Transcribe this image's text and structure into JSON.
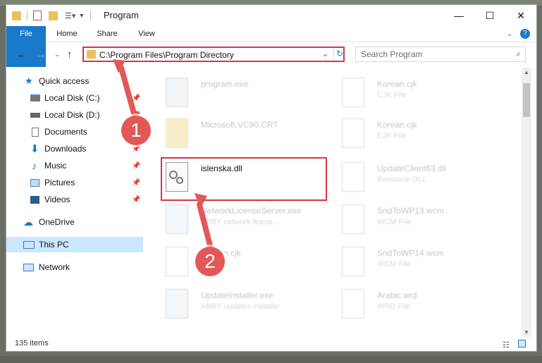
{
  "window": {
    "title": "Program",
    "minimize": "—",
    "maximize": "☐",
    "close": "✕"
  },
  "ribbon": {
    "file": "File",
    "home": "Home",
    "share": "Share",
    "view": "View",
    "help": "?"
  },
  "address": {
    "path": "C:\\Program Files\\Program Directory",
    "search_placeholder": "Search Program"
  },
  "nav": {
    "items": [
      {
        "label": "Quick access"
      },
      {
        "label": "Local Disk (C:)"
      },
      {
        "label": "Local Disk (D:)"
      },
      {
        "label": "Documents"
      },
      {
        "label": "Downloads"
      },
      {
        "label": "Music"
      },
      {
        "label": "Pictures"
      },
      {
        "label": "Videos"
      },
      {
        "label": "OneDrive"
      },
      {
        "label": "This PC"
      },
      {
        "label": "Network"
      }
    ]
  },
  "files": {
    "left": [
      {
        "name": "program.exe",
        "type": ""
      },
      {
        "name": "Microsoft.VC90.CRT",
        "type": ""
      },
      {
        "name": "islenska.dll",
        "type": ""
      },
      {
        "name": "NetworkLicenseServer.exe",
        "type": "ABBY network licens..."
      },
      {
        "name": "Korean.cjk",
        "type": ""
      },
      {
        "name": "UpdateInstaller.exe",
        "type": "ABBY updates installer"
      }
    ],
    "right": [
      {
        "name": "Korean.cjk",
        "type": "CJK File"
      },
      {
        "name": "Korean.cjk",
        "type": "CJK File"
      },
      {
        "name": "UpdateClient63.dll",
        "type": "Resource DLL"
      },
      {
        "name": "SndToWP13.wcm",
        "type": "WCM File"
      },
      {
        "name": "SndToWP14.wcm",
        "type": "WCM File"
      },
      {
        "name": "Arabic.wrd",
        "type": "WRD File"
      }
    ]
  },
  "status": {
    "items": "135 items"
  },
  "annotations": {
    "step1": "1",
    "step2": "2"
  },
  "colors": {
    "accent": "#1979ca",
    "highlight": "#d9363e",
    "badge": "#e25858"
  }
}
